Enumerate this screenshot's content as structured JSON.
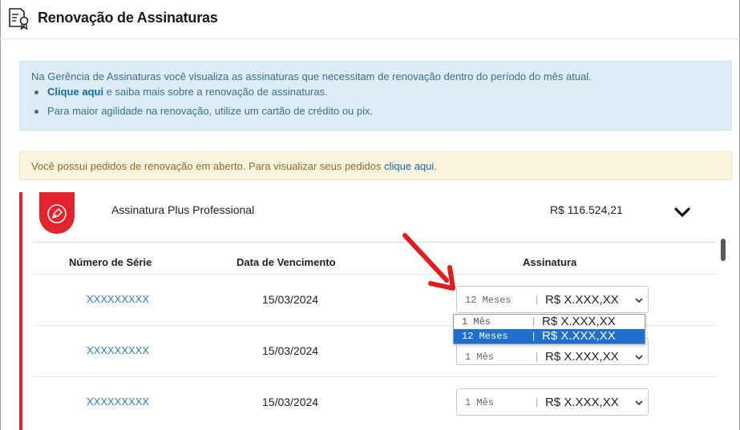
{
  "header": {
    "title": "Renovação de Assinaturas",
    "icon": "certificate-document-icon"
  },
  "info_box": {
    "text": "Na Gerência de Assinaturas você visualiza as assinaturas que necessitam de renovação dentro do período do mês atual.",
    "bullet1_link": "Clique aqui",
    "bullet1_text": " e saiba mais sobre a renovação de assinaturas.",
    "bullet2_text": "Para maior agilidade na renovação, utilize um cartão de crédito ou pix.",
    "color": "#dcedf6"
  },
  "warning_box": {
    "text": "Você possui pedidos de renovação em aberto. Para visualizar seus pedidos ",
    "link": "clique aqui",
    "suffix": ".",
    "color": "#faf3de"
  },
  "subscription": {
    "name": "Assinatura Plus Professional",
    "price": "R$ 116.524,21",
    "accent_color": "#e5232d",
    "badge_icon": "pen-nib-icon",
    "expand_icon": "chevron-down-icon"
  },
  "table": {
    "headers": {
      "serial": "Número de Série",
      "due_date": "Data de Vencimento",
      "subscription": "Assinatura"
    },
    "rows": [
      {
        "serial": "XXXXXXXXX",
        "due_date": "15/03/2024",
        "option": "12 Meses",
        "separator": "|",
        "amount": "R$ X.XXX,XX"
      },
      {
        "serial": "XXXXXXXXX",
        "due_date": "15/03/2024",
        "option": "1 Mês",
        "separator": "|",
        "amount": "R$ X.XXX,XX"
      },
      {
        "serial": "XXXXXXXXX",
        "due_date": "15/03/2024",
        "option": "1 Mês",
        "separator": "|",
        "amount": "R$ X.XXX,XX"
      }
    ]
  },
  "dropdown": {
    "options": [
      {
        "label": "1 Mês",
        "separator": "|",
        "amount": "R$ X.XXX,XX",
        "selected": false
      },
      {
        "label": "12 Meses",
        "separator": "|",
        "amount": "R$ X.XXX,XX",
        "selected": true
      }
    ],
    "highlight_color": "#1f6fd0"
  },
  "annotation": {
    "icon": "red-pointer-arrow-icon",
    "color": "#e21b1b"
  }
}
